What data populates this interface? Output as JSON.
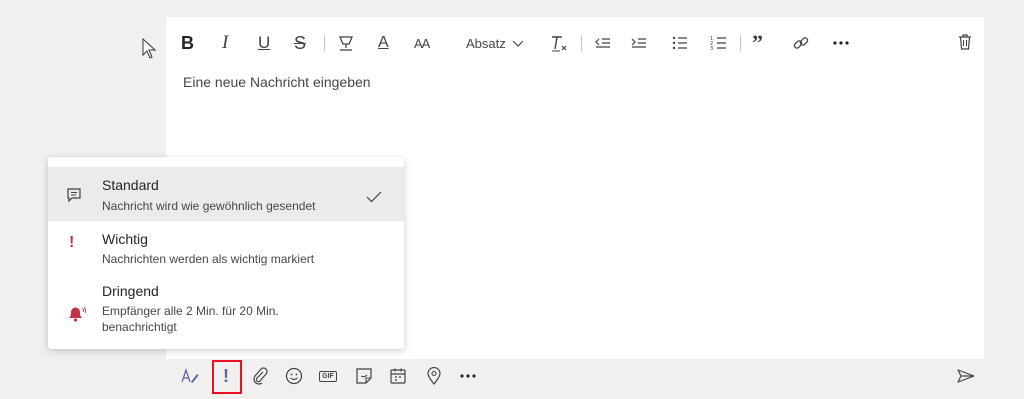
{
  "toolbar": {
    "bold": "B",
    "italic": "I",
    "underline": "U",
    "strikethrough": "S",
    "font_size": "AA",
    "font_color": "A",
    "paragraph_label": "Absatz",
    "quote": "”"
  },
  "editor": {
    "placeholder": "Eine neue Nachricht eingeben"
  },
  "priority_menu": {
    "items": [
      {
        "title": "Standard",
        "subtitle": "Nachricht wird wie gewöhnlich gesendet",
        "icon": "message-icon",
        "selected": true
      },
      {
        "title": "Wichtig",
        "subtitle": "Nachrichten werden als wichtig markiert",
        "icon": "exclamation-icon",
        "selected": false
      },
      {
        "title": "Dringend",
        "subtitle": "Empfänger alle 2 Min. für 20 Min. benachrichtigt",
        "icon": "bell-ringing-icon",
        "selected": false
      }
    ]
  },
  "bottom_toolbar": {
    "importance_glyph": "!",
    "gif_label": "GIF"
  },
  "colors": {
    "accent": "#6264a7",
    "important_red": "#c4314b",
    "highlight_border": "#e81123"
  }
}
